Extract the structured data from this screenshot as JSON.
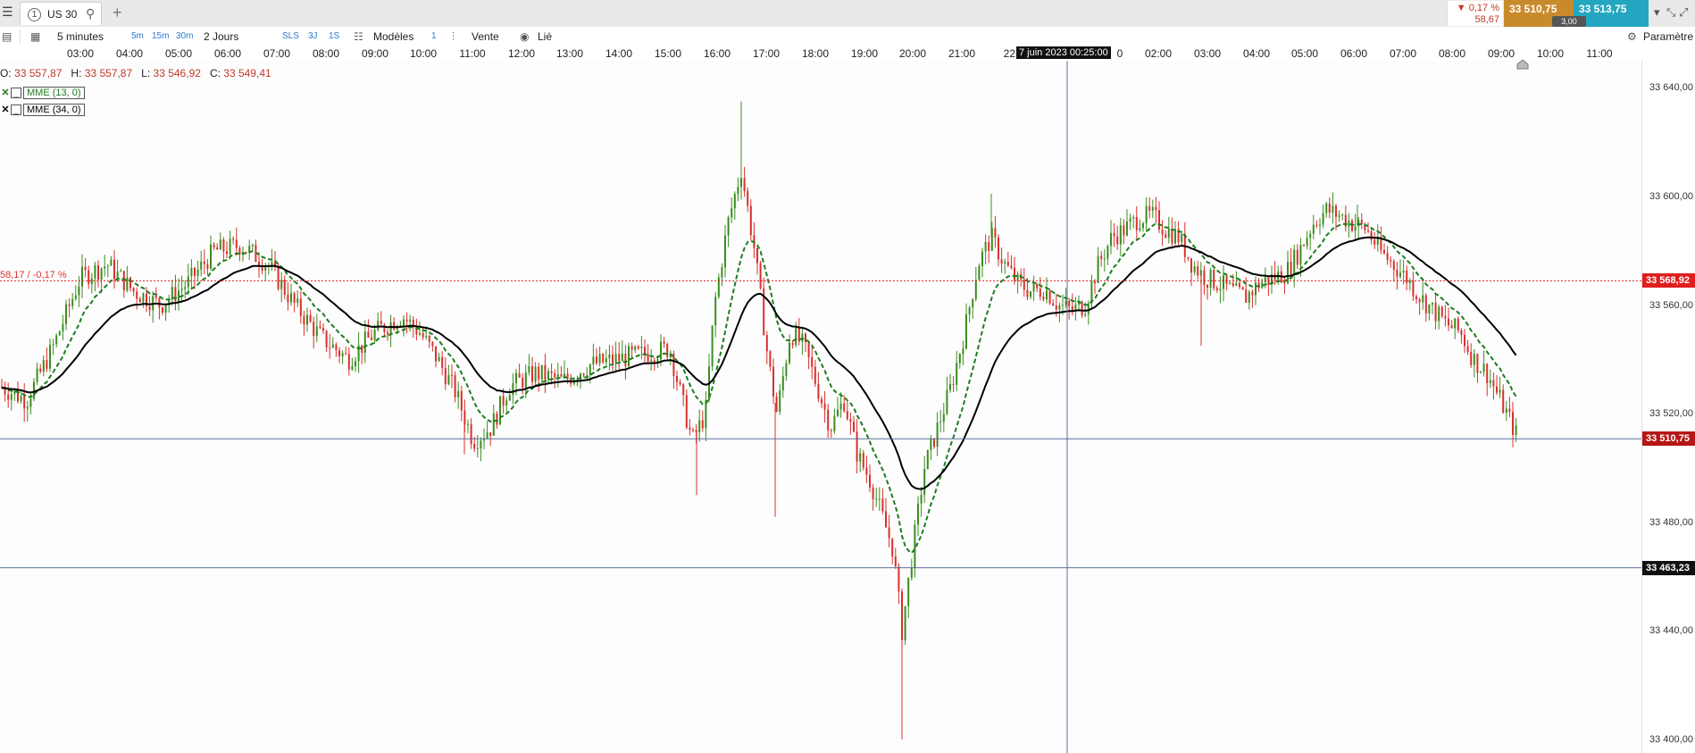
{
  "topbar": {
    "menu_icon": "hamburger-icon",
    "tab_number": "1",
    "tab_label": "US 30",
    "add_tab": "+",
    "change_pct": "▼ 0,17 %",
    "change_abs": "58,67",
    "bid": "33 510,75",
    "ask": "33 513,75",
    "spread": "3,00",
    "colors": {
      "bid": "#c98a2c",
      "ask": "#23a6bf",
      "down": "#c0392b",
      "up": "#3a8d1f"
    }
  },
  "toolbar": {
    "interval": "5 minutes",
    "q5m": "5m",
    "q15m": "15m",
    "q30m": "30m",
    "range": "2 Jours",
    "sls": "SLS",
    "d3": "3J",
    "s1": "1S",
    "templates": "Modèles",
    "count": "1",
    "sell": "Vente",
    "linked": "Lié",
    "settings": "Paramètre"
  },
  "time_axis": [
    "03:00",
    "04:00",
    "05:00",
    "06:00",
    "07:00",
    "08:00",
    "09:00",
    "10:00",
    "11:00",
    "12:00",
    "13:00",
    "14:00",
    "15:00",
    "16:00",
    "17:00",
    "18:00",
    "19:00",
    "20:00",
    "21:00",
    "22:",
    "0",
    "02:00",
    "03:00",
    "04:00",
    "05:00",
    "06:00",
    "07:00",
    "08:00",
    "09:00",
    "10:00",
    "11:00"
  ],
  "cursor_time": "7 juin 2023 00:25:00",
  "ohlc": {
    "o_label": "O:",
    "o": "33 557,87",
    "h_label": "H:",
    "h": "33 557,87",
    "l_label": "L:",
    "l": "33 546,92",
    "c_label": "C:",
    "c": "33 549,41"
  },
  "indicators": [
    {
      "name": "MME (13, 0)",
      "color": "#1e7d1e"
    },
    {
      "name": "MME (34, 0)",
      "color": "#000000"
    }
  ],
  "ref_line_label": "58,17 / -0,17 %",
  "price_axis": {
    "ticks": [
      "33 640,00",
      "33 600,00",
      "33 560,00",
      "33 520,00",
      "33 480,00",
      "33 440,00",
      "33 400,00"
    ],
    "prev_close_tag": "33 568,92",
    "current_tag": "33 510,75",
    "cursor_tag": "33 463,23"
  },
  "chart_data": {
    "type": "candlestick",
    "instrument": "US 30",
    "interval": "5 minutes",
    "ylim": [
      33395,
      33650
    ],
    "prev_close": 33568.92,
    "last": 33510.75,
    "cursor_price": 33463.23,
    "series": [
      {
        "name": "MME (13, 0)",
        "style": "dashed",
        "color": "#1e7d1e"
      },
      {
        "name": "MME (34, 0)",
        "style": "solid",
        "color": "#000000"
      }
    ],
    "close_path": [
      [
        0,
        33530
      ],
      [
        30,
        33525
      ],
      [
        60,
        33545
      ],
      [
        90,
        33570
      ],
      [
        120,
        33575
      ],
      [
        150,
        33565
      ],
      [
        180,
        33560
      ],
      [
        210,
        33568
      ],
      [
        240,
        33580
      ],
      [
        270,
        33582
      ],
      [
        300,
        33575
      ],
      [
        330,
        33560
      ],
      [
        360,
        33548
      ],
      [
        390,
        33540
      ],
      [
        420,
        33550
      ],
      [
        450,
        33556
      ],
      [
        470,
        33550
      ],
      [
        490,
        33540
      ],
      [
        510,
        33528
      ],
      [
        530,
        33510
      ],
      [
        550,
        33515
      ],
      [
        570,
        33530
      ],
      [
        600,
        33535
      ],
      [
        630,
        33532
      ],
      [
        660,
        33538
      ],
      [
        690,
        33540
      ],
      [
        720,
        33542
      ],
      [
        750,
        33544
      ],
      [
        760,
        33530
      ],
      [
        775,
        33510
      ],
      [
        790,
        33520
      ],
      [
        800,
        33560
      ],
      [
        815,
        33590
      ],
      [
        830,
        33610
      ],
      [
        845,
        33580
      ],
      [
        860,
        33540
      ],
      [
        870,
        33520
      ],
      [
        885,
        33550
      ],
      [
        900,
        33545
      ],
      [
        915,
        33530
      ],
      [
        930,
        33515
      ],
      [
        945,
        33525
      ],
      [
        960,
        33505
      ],
      [
        975,
        33495
      ],
      [
        990,
        33480
      ],
      [
        1000,
        33470
      ],
      [
        1010,
        33440
      ],
      [
        1020,
        33465
      ],
      [
        1035,
        33500
      ],
      [
        1050,
        33515
      ],
      [
        1065,
        33530
      ],
      [
        1080,
        33550
      ],
      [
        1095,
        33575
      ],
      [
        1110,
        33585
      ],
      [
        1125,
        33575
      ],
      [
        1140,
        33568
      ],
      [
        1155,
        33565
      ],
      [
        1170,
        33566
      ],
      [
        1185,
        33560
      ],
      [
        1200,
        33558
      ],
      [
        1215,
        33560
      ],
      [
        1230,
        33575
      ],
      [
        1245,
        33585
      ],
      [
        1260,
        33588
      ],
      [
        1275,
        33592
      ],
      [
        1290,
        33593
      ],
      [
        1305,
        33588
      ],
      [
        1320,
        33585
      ],
      [
        1335,
        33575
      ],
      [
        1350,
        33570
      ],
      [
        1365,
        33568
      ],
      [
        1380,
        33565
      ],
      [
        1395,
        33563
      ],
      [
        1410,
        33568
      ],
      [
        1425,
        33570
      ],
      [
        1440,
        33572
      ],
      [
        1455,
        33580
      ],
      [
        1470,
        33590
      ],
      [
        1485,
        33595
      ],
      [
        1500,
        33593
      ],
      [
        1515,
        33590
      ],
      [
        1530,
        33588
      ],
      [
        1545,
        33580
      ],
      [
        1560,
        33575
      ],
      [
        1575,
        33570
      ],
      [
        1590,
        33563
      ],
      [
        1605,
        33558
      ],
      [
        1620,
        33553
      ],
      [
        1635,
        33550
      ],
      [
        1650,
        33540
      ],
      [
        1665,
        33535
      ],
      [
        1680,
        33525
      ],
      [
        1700,
        33511
      ]
    ]
  }
}
